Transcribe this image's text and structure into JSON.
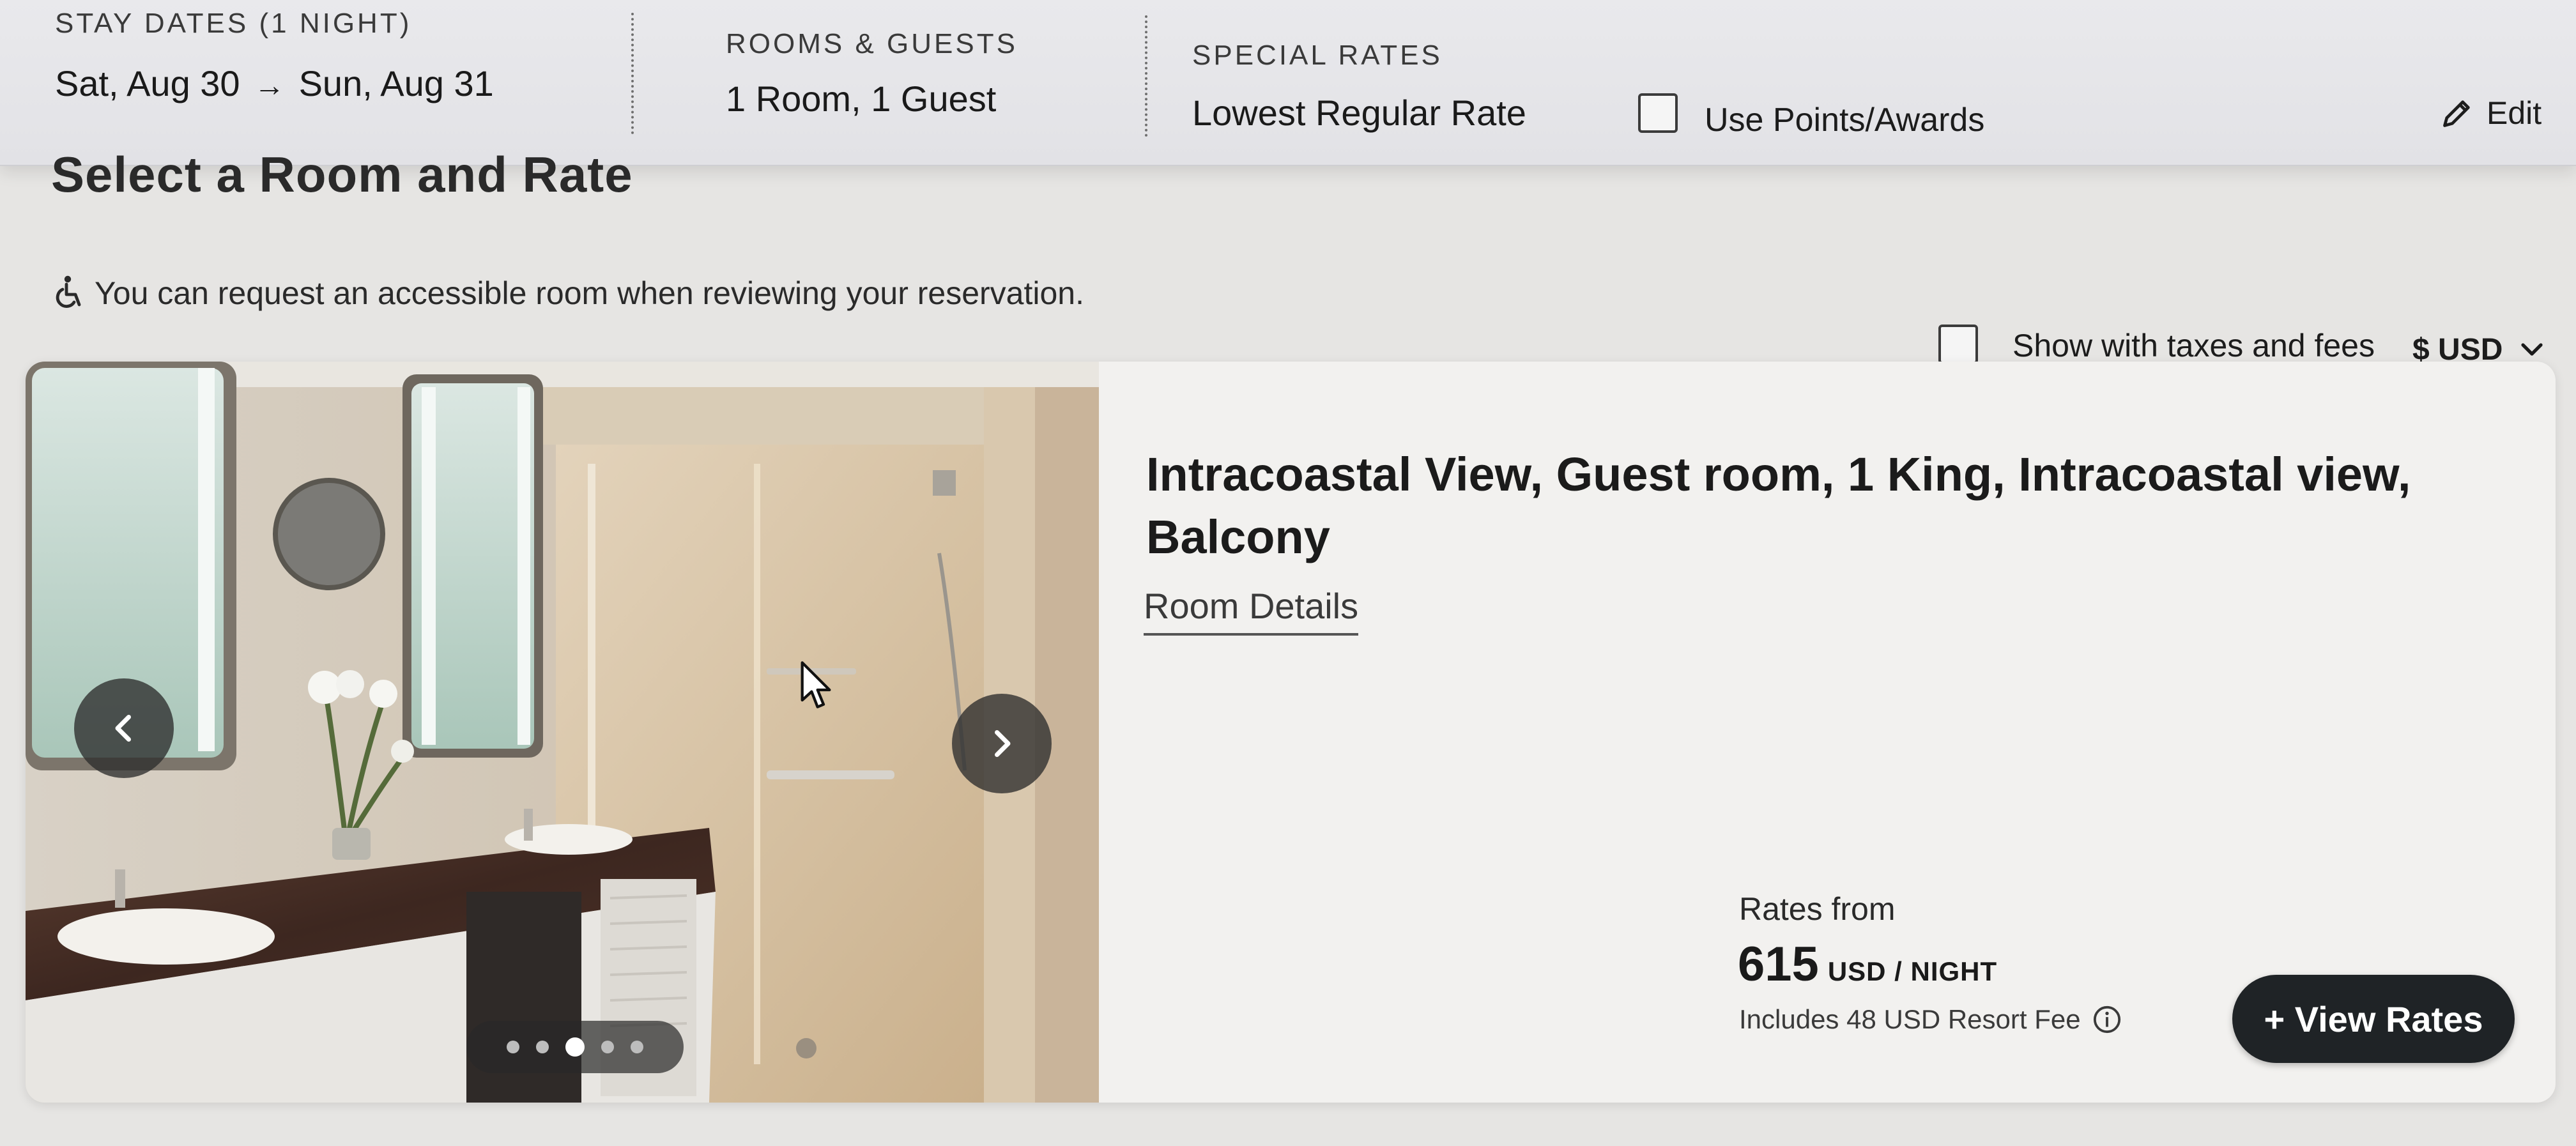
{
  "summary": {
    "stay_dates_label": "STAY DATES (1 NIGHT)",
    "check_in": "Sat, Aug 30",
    "arrow": "→",
    "check_out": "Sun, Aug 31",
    "rooms_guests_label": "ROOMS & GUESTS",
    "rooms_guests_value": "1 Room, 1 Guest",
    "special_rates_label": "SPECIAL RATES",
    "special_rates_value": "Lowest Regular Rate",
    "use_points_label": "Use Points/Awards",
    "use_points_checked": false,
    "edit_label": "Edit"
  },
  "page": {
    "section_title": "Select a Room and Rate",
    "accessible_notice": "You can request an accessible room when reviewing your reservation.",
    "show_taxes_label": "Show with taxes and fees",
    "show_taxes_checked": false,
    "currency_label": "$ USD"
  },
  "room": {
    "title": "Intracoastal View, Guest room, 1 King, Intracoastal view, Balcony",
    "details_link": "Room Details",
    "rates_from_label": "Rates from",
    "price": "615",
    "price_unit": "USD / NIGHT",
    "resort_fee_note": "Includes 48 USD Resort Fee",
    "view_rates_label": "+ View Rates",
    "carousel": {
      "total_slides": 5,
      "active_slide": 3
    }
  },
  "icons": {
    "edit": "pencil-icon",
    "accessible": "wheelchair-icon",
    "currency_dropdown": "chevron-down-icon",
    "carousel_prev": "chevron-left-icon",
    "carousel_next": "chevron-right-icon",
    "fee_info": "info-icon"
  },
  "colors": {
    "primary_button": "#1f2326",
    "card_background": "#f2f1ef",
    "page_background": "#e6e5e3"
  }
}
